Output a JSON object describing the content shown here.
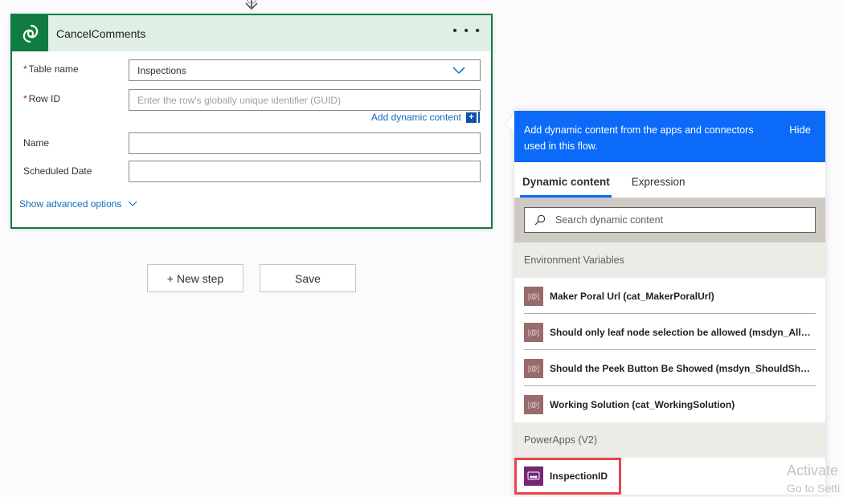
{
  "action_card": {
    "title": "CancelComments",
    "more_icon": "ellipsis-icon",
    "fields": [
      {
        "label": "Table name",
        "required": true,
        "value": "Inspections",
        "placeholder": "",
        "type": "dropdown"
      },
      {
        "label": "Row ID",
        "required": true,
        "value": "",
        "placeholder": "Enter the row's globally unique identifier (GUID)",
        "type": "text"
      },
      {
        "label": "Name",
        "required": false,
        "value": "",
        "placeholder": "",
        "type": "text"
      },
      {
        "label": "Scheduled Date",
        "required": false,
        "value": "",
        "placeholder": "",
        "type": "text"
      }
    ],
    "add_dynamic_content": "Add dynamic content",
    "show_advanced": "Show advanced options",
    "required_marker": "*"
  },
  "buttons": {
    "new_step": "+ New step",
    "save": "Save"
  },
  "dynamic_panel": {
    "header_text": "Add dynamic content from the apps and connectors used in this flow.",
    "hide_label": "Hide",
    "tabs": [
      {
        "label": "Dynamic content",
        "active": true
      },
      {
        "label": "Expression",
        "active": false
      }
    ],
    "search_placeholder": "Search dynamic content",
    "sections": [
      {
        "title": "Environment Variables",
        "items": [
          "Maker Poral Url (cat_MakerPoralUrl)",
          "Should only leaf node selection be allowed (msdyn_AllowS...",
          "Should the Peek Button Be Showed (msdyn_ShouldShowP...",
          "Working Solution (cat_WorkingSolution)"
        ]
      },
      {
        "title": "PowerApps (V2)",
        "items": [
          "InspectionID"
        ]
      }
    ],
    "env_icon_glyph": "[@]"
  },
  "watermark": {
    "line1": "Activate",
    "line2": "Go to Setti"
  },
  "colors": {
    "card_accent": "#107c41",
    "panel_header": "#0b6af8",
    "highlight": "#e8444b",
    "powerapps_icon": "#742774",
    "env_icon": "#996b6b"
  }
}
